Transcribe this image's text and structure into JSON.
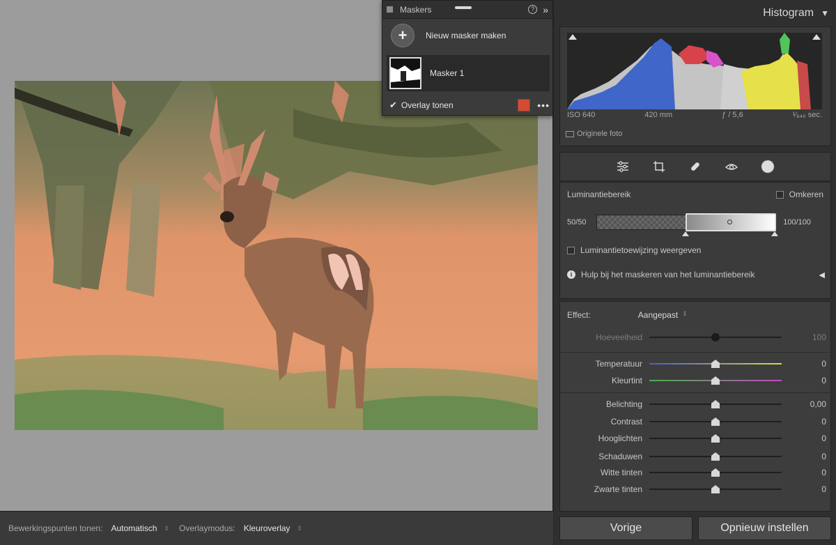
{
  "masks_panel": {
    "title": "Maskers",
    "new_mask_label": "Nieuw masker maken",
    "mask_items": [
      {
        "label": "Masker 1"
      }
    ],
    "overlay_label": "Overlay tonen",
    "overlay_color": "#d64a32"
  },
  "bottom_toolbar": {
    "edit_points_label": "Bewerkingspunten tonen:",
    "edit_points_value": "Automatisch",
    "overlay_mode_label": "Overlaymodus:",
    "overlay_mode_value": "Kleuroverlay"
  },
  "histogram": {
    "title": "Histogram",
    "iso": "ISO 640",
    "focal_length": "420 mm",
    "aperture": "ƒ / 5,6",
    "shutter": "¹⁄₆₄₀ sec.",
    "original_photo_label": "Originele foto"
  },
  "tools": [
    "sliders-icon",
    "crop-icon",
    "healing-icon",
    "redeye-icon",
    "mask-icon"
  ],
  "luminance": {
    "title": "Luminantiebereik",
    "invert_label": "Omkeren",
    "range_left": "50/50",
    "range_right": "100/100",
    "show_map_label": "Luminantietoewijzing weergeven",
    "help_label": "Hulp bij het maskeren van het luminantiebereik"
  },
  "effect": {
    "label": "Effect:",
    "preset": "Aangepast",
    "amount": {
      "label": "Hoeveelheid",
      "value": "100"
    },
    "sliders": [
      {
        "label": "Temperatuur",
        "value": "0"
      },
      {
        "label": "Kleurtint",
        "value": "0"
      },
      {
        "label": "Belichting",
        "value": "0,00"
      },
      {
        "label": "Contrast",
        "value": "0"
      },
      {
        "label": "Hooglichten",
        "value": "0"
      },
      {
        "label": "Schaduwen",
        "value": "0"
      },
      {
        "label": "Witte tinten",
        "value": "0"
      },
      {
        "label": "Zwarte tinten",
        "value": "0"
      }
    ]
  },
  "buttons": {
    "previous": "Vorige",
    "reset": "Opnieuw instellen"
  }
}
